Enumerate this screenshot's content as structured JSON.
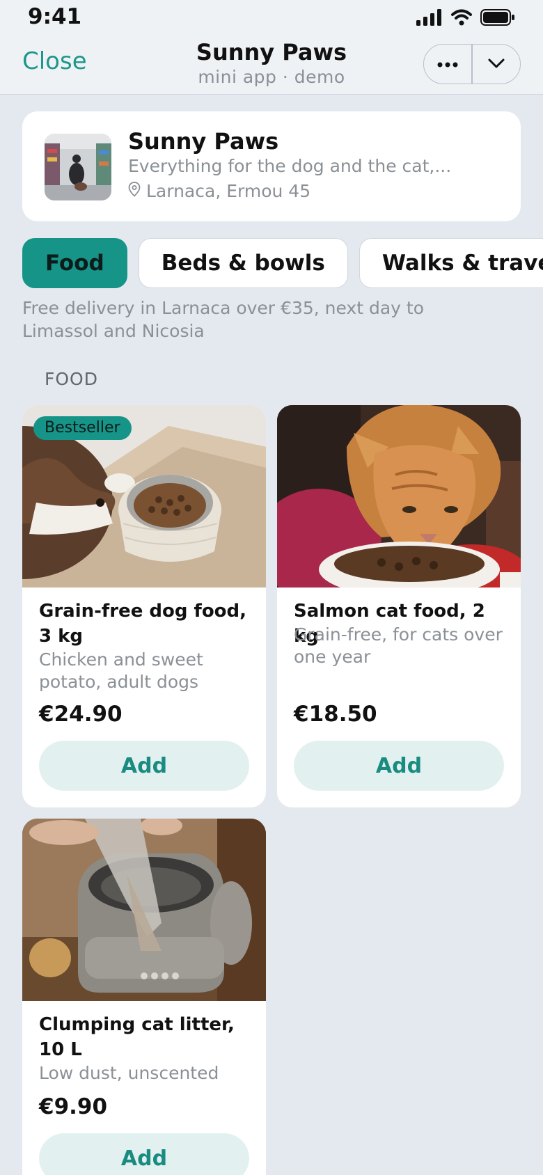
{
  "status_bar": {
    "time": "9:41"
  },
  "nav": {
    "close_label": "Close",
    "title": "Sunny Paws",
    "subtitle": "mini app · demo"
  },
  "shop": {
    "name": "Sunny Paws",
    "description": "Everything for the dog and the cat,...",
    "location": "Larnaca, Ermou 45"
  },
  "tabs": [
    {
      "label": "Food",
      "active": true
    },
    {
      "label": "Beds & bowls",
      "active": false
    },
    {
      "label": "Walks & travel",
      "active": false
    }
  ],
  "delivery_note": "Free delivery in Larnaca over €35, next day to Limassol and Nicosia",
  "section_label": "FOOD",
  "products": [
    {
      "badge": "Bestseller",
      "title": "Grain-free dog food, 3 kg",
      "description": "Chicken and sweet potato, adult dogs",
      "price": "€24.90",
      "add_label": "Add"
    },
    {
      "badge": "",
      "title": "Salmon cat food, 2 kg",
      "description": "Grain-free, for cats over one year",
      "price": "€18.50",
      "add_label": "Add"
    },
    {
      "badge": "",
      "title": "Clumping cat litter, 10 L",
      "description": "Low dust, unscented",
      "price": "€9.90",
      "add_label": "Add"
    }
  ],
  "colors": {
    "accent": "#179488",
    "accent_text": "#1e968a",
    "add_button_bg": "#e2f1f0",
    "background": "#e3e9ef"
  },
  "icons": [
    "signal-icon",
    "wifi-icon",
    "battery-icon",
    "more-icon",
    "chevron-down-icon",
    "location-pin-icon"
  ]
}
